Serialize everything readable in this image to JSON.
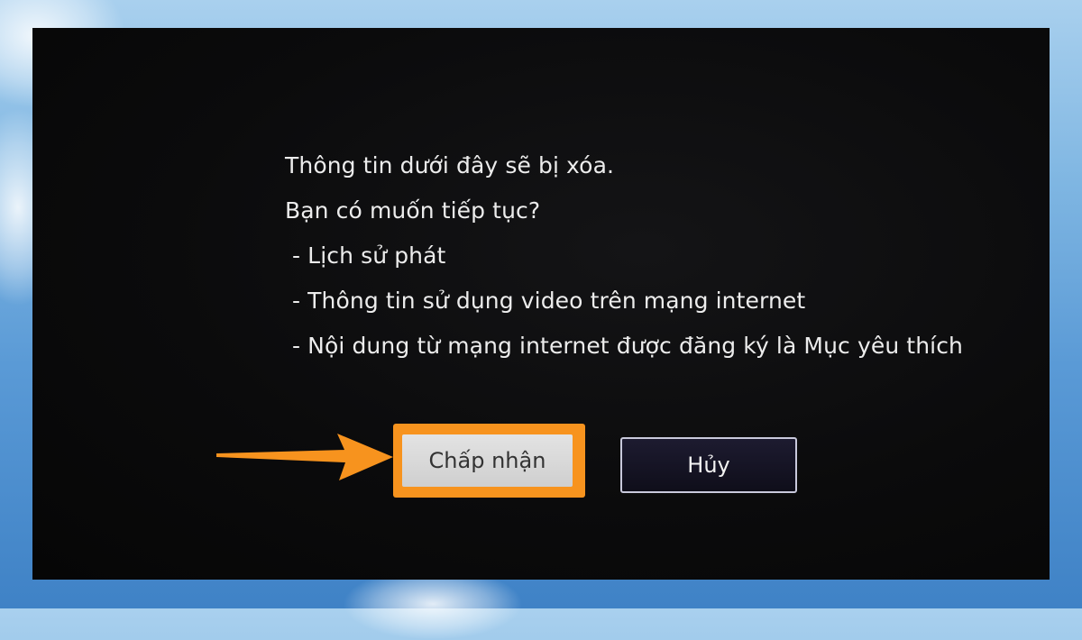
{
  "dialog": {
    "lines": [
      "Thông tin dưới đây sẽ bị xóa.",
      "Bạn có muốn tiếp tục?"
    ],
    "items": [
      "- Lịch sử phát",
      "- Thông tin sử dụng video trên mạng internet",
      "- Nội dung từ mạng internet được đăng ký là Mục yêu thích"
    ],
    "accept_label": "Chấp nhận",
    "cancel_label": "Hủy"
  },
  "colors": {
    "highlight": "#f7931e",
    "screen_background": "#0b0b0c",
    "text": "#ececec"
  },
  "icons": {
    "pointer": "arrow-right-icon"
  }
}
